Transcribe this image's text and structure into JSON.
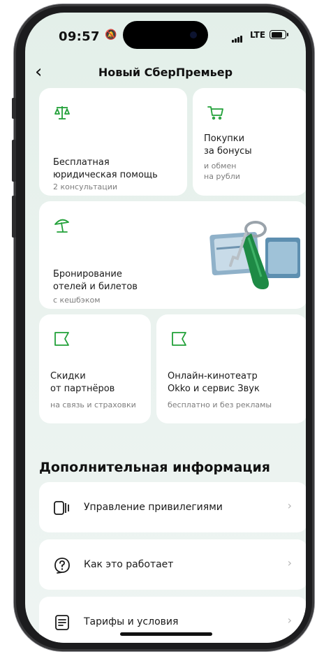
{
  "status_bar": {
    "time": "09:57",
    "network": "LTE"
  },
  "nav": {
    "back_icon": "chevron-left-icon",
    "title": "Новый СберПремьер"
  },
  "colors": {
    "accent": "#21A038",
    "card": "#ffffff",
    "background": "#e8f1ed"
  },
  "cards": [
    {
      "title_line1": "Бесплатная",
      "title_line2": "юридическая помощь",
      "subtitle": "2 консультации",
      "icon": "scales-icon"
    },
    {
      "title_line1": "Покупки",
      "title_line2": "за бонусы",
      "subtitle_line1": "и обмен",
      "subtitle_line2": "на рубли",
      "icon": "cart-icon"
    },
    {
      "title_line1": "Бронирование",
      "title_line2": "отелей и билетов",
      "subtitle": "с кешбэком",
      "icon": "beach-umbrella-icon",
      "illustration": "cards-and-keys-illustration"
    },
    {
      "title_line1": "Скидки",
      "title_line2": "от партнёров",
      "subtitle": "на связь и страховки",
      "icon": "flag-icon"
    },
    {
      "title_line1": "Онлайн-кинотеатр",
      "title_line2": "Okko и сервис Звук",
      "subtitle": "бесплатно и без рекламы",
      "icon": "flag-icon"
    }
  ],
  "extra": {
    "title": "Дополнительная информация",
    "items": [
      {
        "label": "Управление привилегиями",
        "icon": "cards-stack-icon"
      },
      {
        "label": "Как это работает",
        "icon": "help-circle-icon"
      },
      {
        "label": "Тарифы и условия",
        "icon": "document-icon"
      }
    ]
  }
}
